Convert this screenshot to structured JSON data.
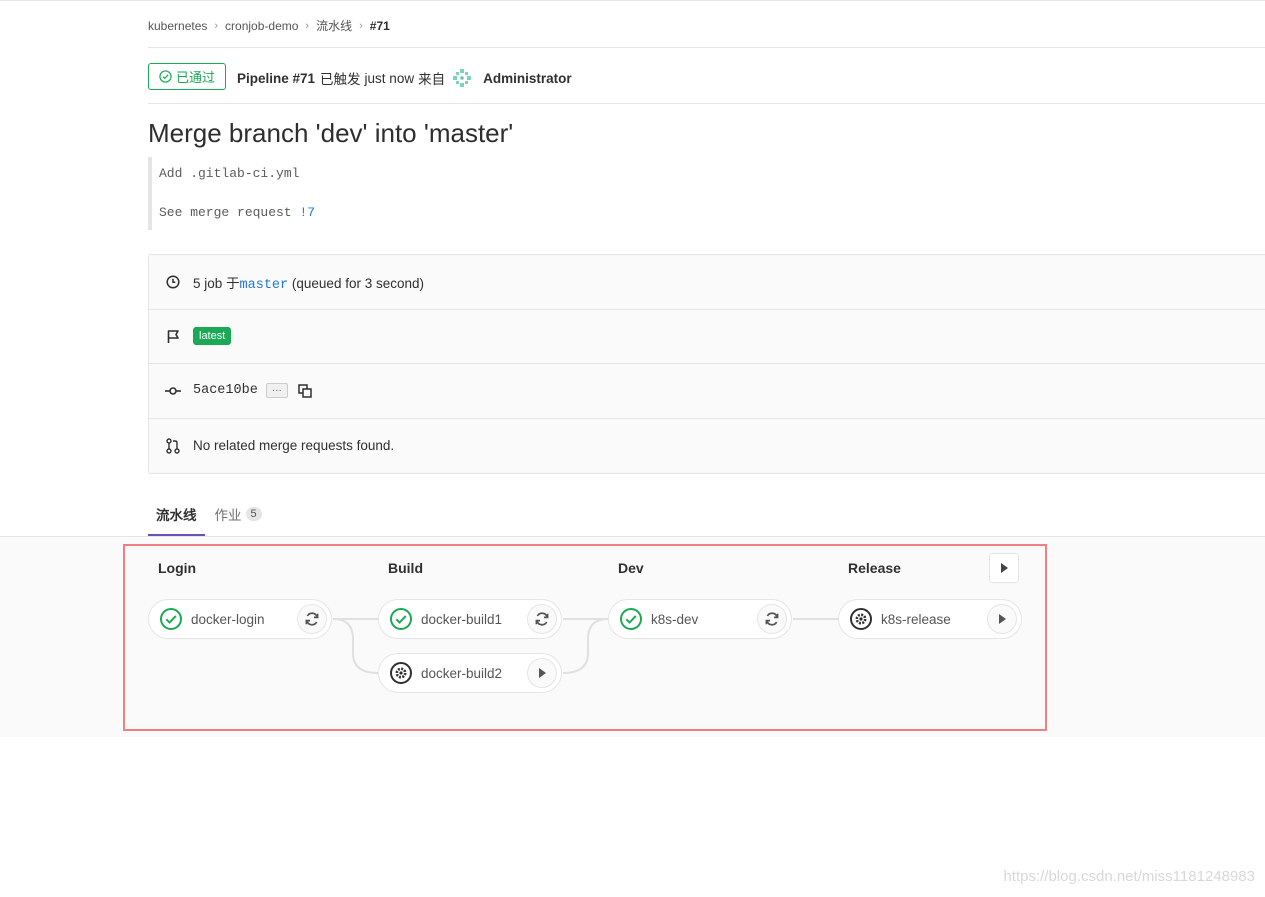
{
  "breadcrumb": [
    "kubernetes",
    "cronjob-demo",
    "流水线",
    "#71"
  ],
  "header": {
    "status": "已通过",
    "pipeline": "Pipeline #71",
    "triggered": "已触发",
    "time": "just now",
    "from": "来自",
    "user": "Administrator"
  },
  "commit": {
    "title": "Merge branch 'dev' into 'master'",
    "body_line1": "Add .gitlab-ci.yml",
    "body_line2_prefix": "See merge request ",
    "body_line2_link": "!7"
  },
  "info": {
    "jobs_prefix": "5 job 于",
    "branch": "master",
    "queued": "(queued for 3 second)",
    "tag": "latest",
    "sha": "5ace10be",
    "ellipsis": "···",
    "mr_text": "No related merge requests found."
  },
  "tabs": [
    {
      "label": "流水线"
    },
    {
      "label": "作业",
      "count": "5"
    }
  ],
  "stages": [
    {
      "name": "Login",
      "jobs": [
        {
          "name": "docker-login",
          "status": "success",
          "action": "retry"
        }
      ]
    },
    {
      "name": "Build",
      "jobs": [
        {
          "name": "docker-build1",
          "status": "success",
          "action": "retry"
        },
        {
          "name": "docker-build2",
          "status": "manual",
          "action": "play"
        }
      ]
    },
    {
      "name": "Dev",
      "jobs": [
        {
          "name": "k8s-dev",
          "status": "success",
          "action": "retry"
        }
      ]
    },
    {
      "name": "Release",
      "jobs": [
        {
          "name": "k8s-release",
          "status": "manual",
          "action": "play"
        }
      ]
    }
  ],
  "colors": {
    "success": "#1aaa55",
    "accent": "#6b4fbb",
    "link": "#1f78d1",
    "highlight": "#f08080"
  },
  "watermark": "https://blog.csdn.net/miss1181248983"
}
